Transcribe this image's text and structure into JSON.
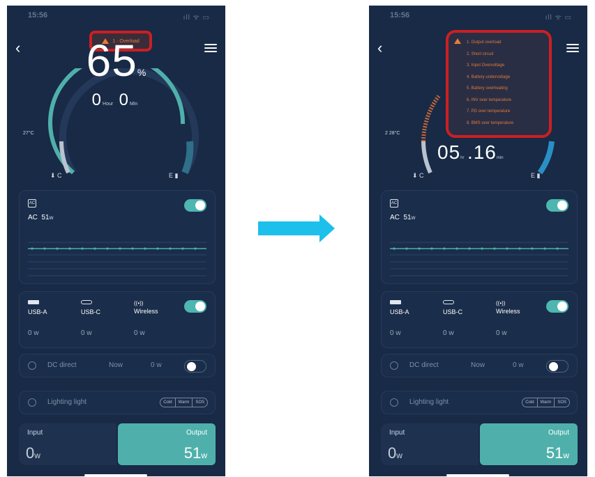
{
  "left_screen": {
    "time": "15:56",
    "signal": "ıll ᯤ ▭",
    "alert_pill": "1 · Overload",
    "battery_percent": "65",
    "percent_unit": "%",
    "time_remaining": {
      "hours": "0",
      "hour_unit": "Hour",
      "minutes": "0",
      "minute_unit": "Min"
    },
    "temperature": "27°C",
    "cold_label": "C",
    "empty_label": "E",
    "ac": {
      "icon": "AC",
      "label": "AC",
      "value": "51",
      "unit": "w"
    },
    "ports": [
      {
        "name": "USB-A",
        "value": "0 w"
      },
      {
        "name": "USB-C",
        "value": "0 w"
      },
      {
        "name": "Wireless",
        "value": "0 w"
      }
    ],
    "dc": {
      "label": "DC direct",
      "now": "Now",
      "value": "0 w"
    },
    "lighting": {
      "label": "Lighting light",
      "modes": [
        "Cold",
        "Warm",
        "SOS"
      ]
    },
    "input": {
      "label": "Input",
      "value": "0",
      "unit": "w"
    },
    "output": {
      "label": "Output",
      "value": "51",
      "unit": "w"
    }
  },
  "right_screen": {
    "time": "15:56",
    "signal": "ıll ᯤ ▭",
    "time_remaining": {
      "hours": "05",
      "hour_unit": "hr",
      "minutes": "16",
      "minute_unit": "min"
    },
    "temperature": "2 28°C",
    "cold_label": "C",
    "empty_label": "E",
    "errors": [
      "1. Output overload",
      "2. Short circuit",
      "3. Input Overvoltage",
      "4. Battery undervoltage",
      "5. Battery overheating",
      "6. INV over temperature",
      "7. PD over temperature",
      "8. BMS over temperature"
    ],
    "ac": {
      "icon": "AC",
      "label": "AC",
      "value": "51",
      "unit": "w"
    },
    "ports": [
      {
        "name": "USB-A",
        "value": "0 w"
      },
      {
        "name": "USB-C",
        "value": "0 w"
      },
      {
        "name": "Wireless",
        "value": "0 w"
      }
    ],
    "dc": {
      "label": "DC direct",
      "now": "Now",
      "value": "0 w"
    },
    "lighting": {
      "label": "Lighting light",
      "modes": [
        "Cold",
        "Warm",
        "SOS"
      ]
    },
    "input": {
      "label": "Input",
      "value": "0",
      "unit": "w"
    },
    "output": {
      "label": "Output",
      "value": "51",
      "unit": "w"
    }
  },
  "colors": {
    "accent": "#4fb0ab",
    "background": "#182a45",
    "alert": "#cc1f22",
    "warning_text": "#e97a3a",
    "arrow": "#1cc0ea"
  },
  "icons": [
    "back-chevron-icon",
    "settings-sliders-icon",
    "warning-icon",
    "thermometer-icon",
    "fuel-icon",
    "usb-a-icon",
    "usb-c-icon",
    "wireless-icon",
    "dc-icon",
    "bulb-icon",
    "right-arrow-icon"
  ]
}
